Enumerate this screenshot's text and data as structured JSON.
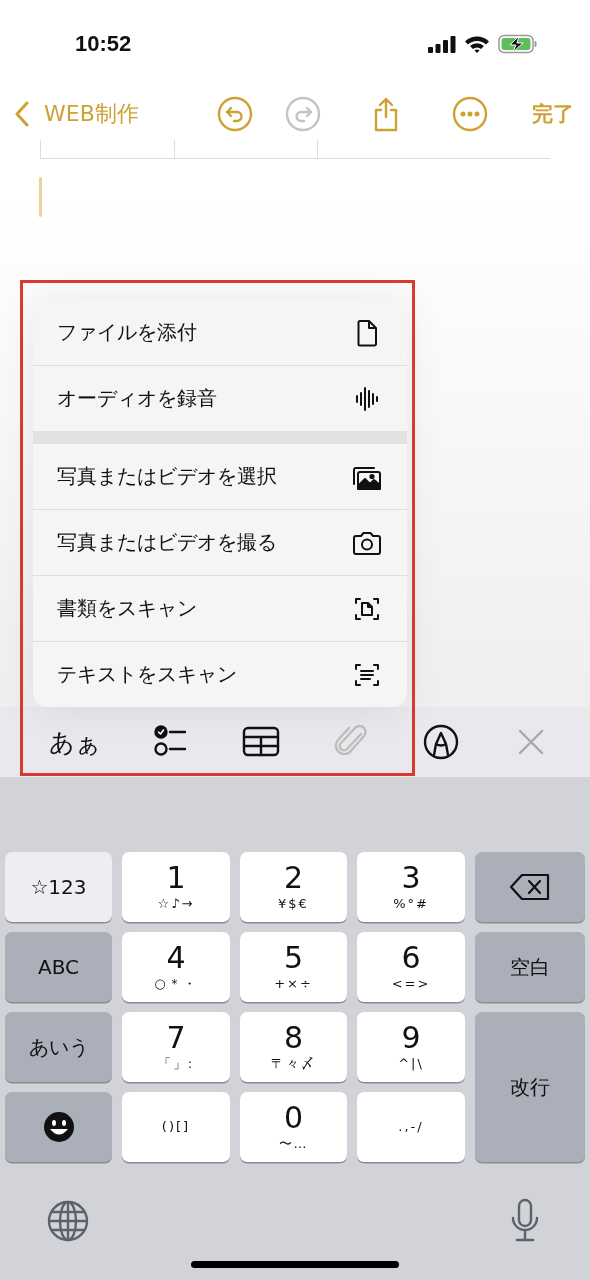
{
  "status_bar": {
    "time": "10:52",
    "charging": true
  },
  "nav": {
    "back_label": "WEB制作",
    "done_label": "完了",
    "buttons": [
      {
        "kind": "undo",
        "disabled": false
      },
      {
        "kind": "redo",
        "disabled": true
      },
      {
        "kind": "share",
        "disabled": false
      },
      {
        "kind": "more",
        "disabled": false
      }
    ]
  },
  "attach_menu": {
    "groups": [
      [
        {
          "label": "ファイルを添付"
        },
        {
          "label": "オーディオを録音"
        }
      ],
      [
        {
          "label": "写真またはビデオを選択"
        },
        {
          "label": "写真またはビデオを撮る"
        },
        {
          "label": "書類をスキャン"
        },
        {
          "label": "テキストをスキャン"
        }
      ]
    ]
  },
  "toolbar": {
    "items": [
      {
        "kind": "text-style",
        "label": "あぁ",
        "disabled": false
      },
      {
        "kind": "checklist",
        "disabled": false
      },
      {
        "kind": "table",
        "disabled": false
      },
      {
        "kind": "attachment",
        "disabled": true
      },
      {
        "kind": "markup",
        "disabled": false
      },
      {
        "kind": "close",
        "disabled": false
      }
    ]
  },
  "keyboard": {
    "rows": [
      [
        {
          "kind": "mode",
          "label": "☆123",
          "selected": true
        },
        {
          "kind": "digit",
          "label": "1",
          "sub": "☆♪→"
        },
        {
          "kind": "digit",
          "label": "2",
          "sub": "¥$€"
        },
        {
          "kind": "digit",
          "label": "3",
          "sub": "%°#"
        },
        {
          "kind": "delete"
        }
      ],
      [
        {
          "kind": "mode",
          "label": "ABC",
          "selected": false
        },
        {
          "kind": "digit",
          "label": "4",
          "sub": "○＊・"
        },
        {
          "kind": "digit",
          "label": "5",
          "sub": "+×÷"
        },
        {
          "kind": "digit",
          "label": "6",
          "sub": "<=>"
        },
        {
          "kind": "action",
          "label": "空白"
        }
      ],
      [
        {
          "kind": "mode",
          "label": "あいう",
          "selected": false
        },
        {
          "kind": "digit",
          "label": "7",
          "sub": "「」:"
        },
        {
          "kind": "digit",
          "label": "8",
          "sub": "〒々〆"
        },
        {
          "kind": "digit",
          "label": "9",
          "sub": "^|\\"
        },
        {
          "kind": "return",
          "label": "改行"
        }
      ],
      [
        {
          "kind": "emoji"
        },
        {
          "kind": "digit",
          "sub": "()[]"
        },
        {
          "kind": "digit",
          "label": "0",
          "sub": "〜…"
        },
        {
          "kind": "digit",
          "sub": ".,-/"
        }
      ]
    ]
  }
}
